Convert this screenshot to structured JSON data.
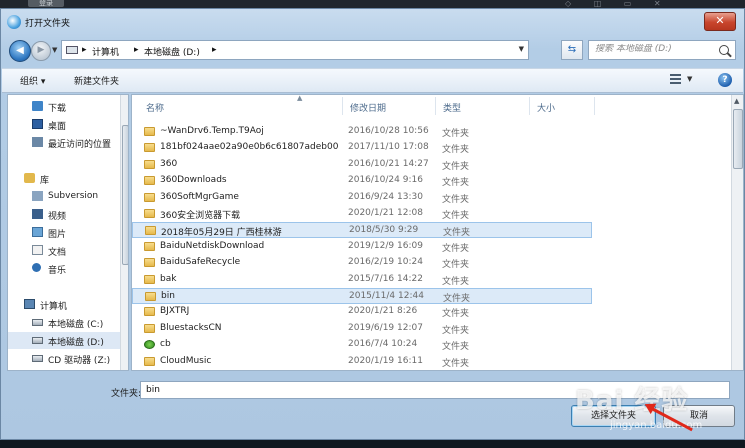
{
  "desktop": {
    "tab_label": "登录"
  },
  "window": {
    "title": "打开文件夹",
    "close_label": "✕"
  },
  "address_bar": {
    "crumbs": [
      "计算机",
      "本地磁盘 (D:)"
    ],
    "search_placeholder": "搜索 本地磁盘 (D:)"
  },
  "toolbar": {
    "organize": "组织 ▾",
    "new_folder": "新建文件夹",
    "help": "?"
  },
  "nav": {
    "items": [
      {
        "label": "下载",
        "icon": "download-folder-icon"
      },
      {
        "label": "桌面",
        "icon": "desktop-icon"
      },
      {
        "label": "最近访问的位置",
        "icon": "recent-places-icon"
      },
      {
        "label": "库",
        "icon": "libraries-icon"
      },
      {
        "label": "Subversion",
        "icon": "subversion-icon"
      },
      {
        "label": "视频",
        "icon": "videos-icon"
      },
      {
        "label": "图片",
        "icon": "pictures-icon"
      },
      {
        "label": "文档",
        "icon": "documents-icon"
      },
      {
        "label": "音乐",
        "icon": "music-icon"
      },
      {
        "label": "计算机",
        "icon": "computer-icon"
      },
      {
        "label": "本地磁盘 (C:)",
        "icon": "drive-c-icon"
      },
      {
        "label": "本地磁盘 (D:)",
        "icon": "drive-d-icon"
      },
      {
        "label": "CD 驱动器 (Z:)",
        "icon": "cd-drive-icon"
      }
    ]
  },
  "columns": {
    "name": "名称",
    "date": "修改日期",
    "type": "类型",
    "size": "大小"
  },
  "files": [
    {
      "name": "~WanDrv6.Temp.T9Aoj",
      "date": "2016/10/28 10:56",
      "type": "文件夹"
    },
    {
      "name": "181bf024aae02a90e0b6c61807adeb00",
      "date": "2017/11/10 17:08",
      "type": "文件夹"
    },
    {
      "name": "360",
      "date": "2016/10/21 14:27",
      "type": "文件夹"
    },
    {
      "name": "360Downloads",
      "date": "2016/10/24 9:16",
      "type": "文件夹"
    },
    {
      "name": "360SoftMgrGame",
      "date": "2016/9/24 13:30",
      "type": "文件夹"
    },
    {
      "name": "360安全浏览器下载",
      "date": "2020/1/21 12:08",
      "type": "文件夹"
    },
    {
      "name": "2018年05月29日 广西桂林游",
      "date": "2018/5/30 9:29",
      "type": "文件夹"
    },
    {
      "name": "BaiduNetdiskDownload",
      "date": "2019/12/9 16:09",
      "type": "文件夹"
    },
    {
      "name": "BaiduSafeRecycle",
      "date": "2016/2/19 10:24",
      "type": "文件夹"
    },
    {
      "name": "bak",
      "date": "2015/7/16 14:22",
      "type": "文件夹"
    },
    {
      "name": "bin",
      "date": "2015/11/4 12:44",
      "type": "文件夹"
    },
    {
      "name": "BJXTRJ",
      "date": "2020/1/21 8:26",
      "type": "文件夹"
    },
    {
      "name": "BluestacksCN",
      "date": "2019/6/19 12:07",
      "type": "文件夹"
    },
    {
      "name": "cb",
      "date": "2016/7/4 10:24",
      "type": "文件夹"
    },
    {
      "name": "CloudMusic",
      "date": "2020/1/19 16:11",
      "type": "文件夹"
    }
  ],
  "bottom": {
    "filename_label": "文件夹:",
    "filename_value": "bin",
    "select_button": "选择文件夹",
    "cancel_button": "取消"
  },
  "watermark": {
    "main": "Bai 经验",
    "sub": "jingyan.baidu.com"
  }
}
